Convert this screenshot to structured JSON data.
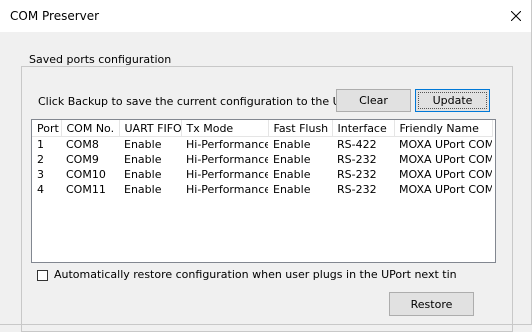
{
  "window": {
    "title": "COM Preserver",
    "close_glyph": "✕"
  },
  "group": {
    "label": "Saved ports configuration",
    "hint": "Click Backup to save the current configuration to the UPort"
  },
  "buttons": {
    "clear": "Clear",
    "update": "Update",
    "restore": "Restore"
  },
  "table": {
    "headers": [
      "Port",
      "COM No.",
      "UART FIFO",
      "Tx Mode",
      "Fast Flush",
      "Interface",
      "Friendly Name"
    ],
    "rows": [
      [
        "1",
        "COM8",
        "Enable",
        "Hi-Performance",
        "Enable",
        "RS-422",
        "MOXA UPort COM"
      ],
      [
        "2",
        "COM9",
        "Enable",
        "Hi-Performance",
        "Enable",
        "RS-232",
        "MOXA UPort COM"
      ],
      [
        "3",
        "COM10",
        "Enable",
        "Hi-Performance",
        "Enable",
        "RS-232",
        "MOXA UPort COM"
      ],
      [
        "4",
        "COM11",
        "Enable",
        "Hi-Performance",
        "Enable",
        "RS-232",
        "MOXA UPort COM"
      ]
    ]
  },
  "auto_restore": {
    "label": "Automatically restore configuration when user plugs in the UPort next tin",
    "checked": false
  }
}
